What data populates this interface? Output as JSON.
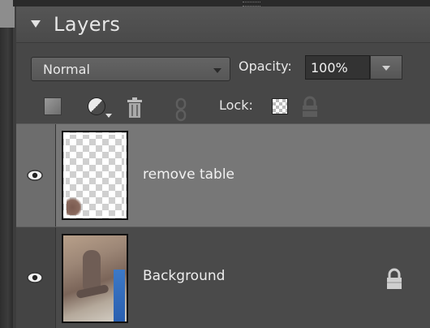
{
  "panel": {
    "title": "Layers"
  },
  "blend_mode": {
    "selected": "Normal"
  },
  "opacity": {
    "label": "Opacity:",
    "value": "100%"
  },
  "toolbar": {
    "lock_label": "Lock:"
  },
  "layers": [
    {
      "name": "remove table",
      "selected": true,
      "visible": true,
      "thumbnail": "transparent-checkerboard"
    },
    {
      "name": "Background",
      "selected": false,
      "visible": true,
      "locked": true,
      "thumbnail": "photo"
    }
  ],
  "colors": {
    "panel_bg": "#474747",
    "selected_row": "#777777",
    "text": "#e8e8e8"
  }
}
